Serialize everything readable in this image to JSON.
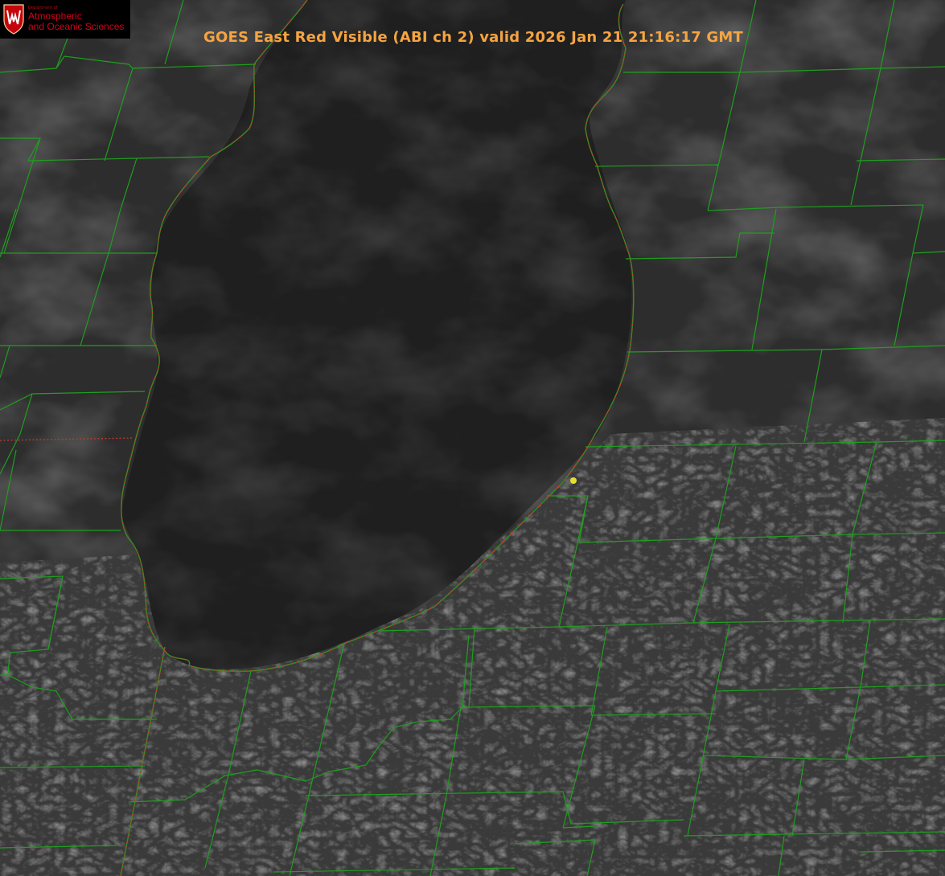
{
  "title": "GOES East Red Visible (ABI ch 2) valid 2026 Jan 21 21:16:17 GMT",
  "logo": {
    "department": "Department of",
    "line1": "Atmospheric",
    "line2": "and Oceanic Sciences",
    "emblem": "uw-crest-logo"
  },
  "map": {
    "product": "visible-satellite-imagery",
    "layers": [
      "county-boundaries",
      "state-boundary",
      "shoreline"
    ],
    "colors": {
      "county_lines": "#1f9e1f",
      "state_boundary": "#c0392b",
      "marker": "#e6e02a",
      "title_text": "#f5a442"
    },
    "marker": "station-dot"
  }
}
